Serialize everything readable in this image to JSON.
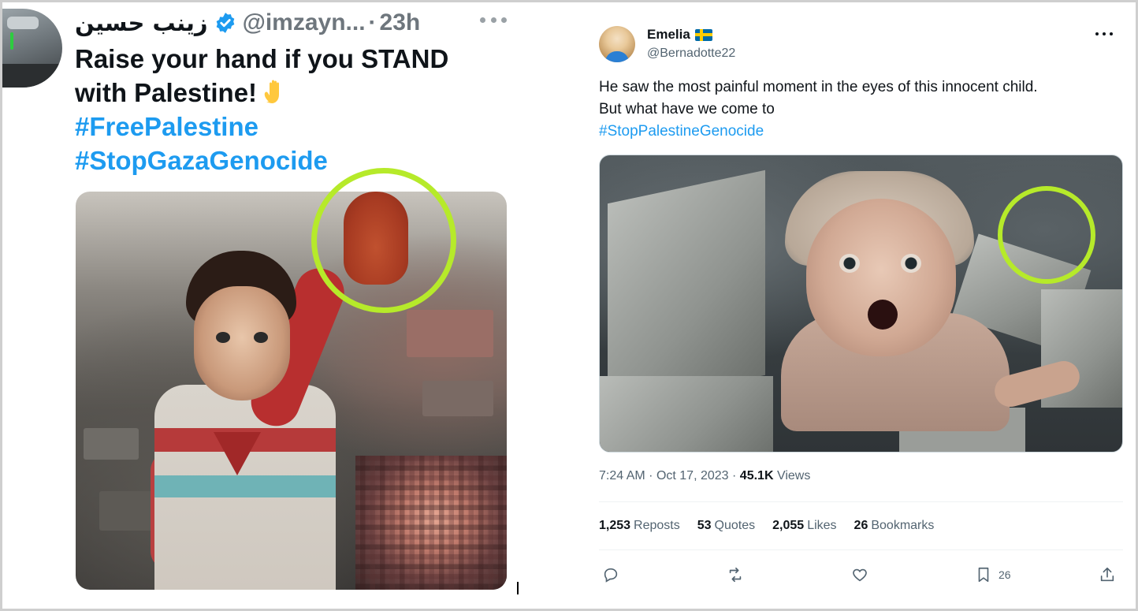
{
  "left_tweet": {
    "display_name": "زينب حسين",
    "handle": "@imzayn...",
    "separator": "·",
    "time": "23h",
    "text_line1": "Raise your hand if you STAND",
    "text_line2": "with Palestine!",
    "hashtags": [
      "#FreePalestine",
      "#StopGazaGenocide"
    ],
    "highlight_color": "#b6ea2a"
  },
  "right_tweet": {
    "display_name": "Emelia",
    "handle": "@Bernadotte22",
    "text_line1": "He saw the most painful moment in the eyes of this innocent child.",
    "text_line2": "But what have we come to",
    "hashtag": "#StopPalestineGenocide",
    "time": "7:24 AM",
    "date": "Oct 17, 2023",
    "views_count": "45.1K",
    "views_label": "Views",
    "stats": {
      "reposts_count": "1,253",
      "reposts_label": "Reposts",
      "quotes_count": "53",
      "quotes_label": "Quotes",
      "likes_count": "2,055",
      "likes_label": "Likes",
      "bookmarks_count": "26",
      "bookmarks_label": "Bookmarks"
    },
    "bookmark_action_count": "26",
    "accent_color": "#1d9bf0"
  }
}
